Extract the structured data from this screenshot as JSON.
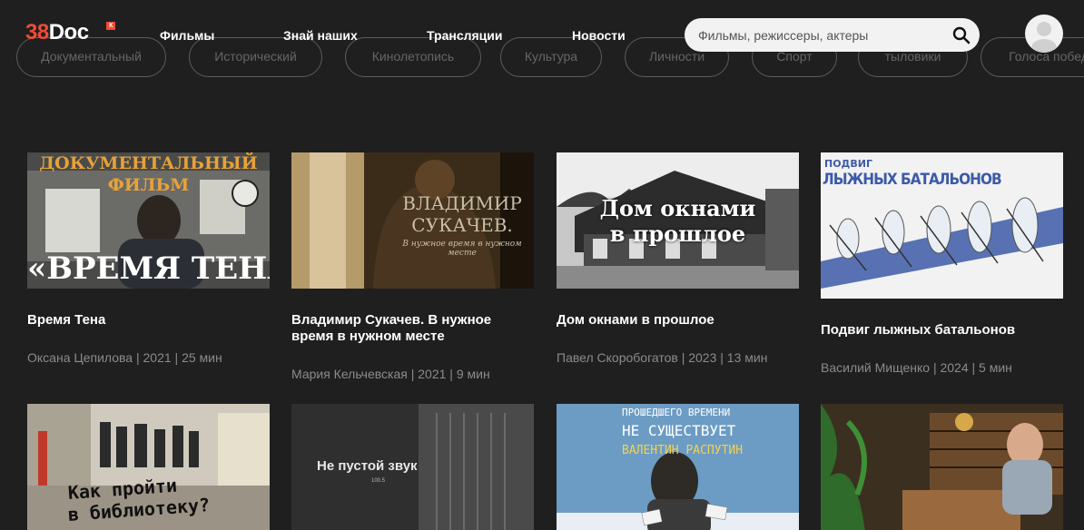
{
  "logo": {
    "number": "38",
    "text": "Doc",
    "mark": "К"
  },
  "nav": {
    "items": [
      "Фильмы",
      "Знай наших",
      "Трансляции",
      "Новости"
    ]
  },
  "search": {
    "placeholder": "Фильмы, режиссеры, актеры",
    "value": ""
  },
  "categories": [
    "Документальный",
    "Исторический",
    "Кинолетопись",
    "Культура",
    "Личности",
    "Спорт",
    "тыловики",
    "Голоса побед"
  ],
  "cards": [
    {
      "title": "Время Тена",
      "meta": "Оксана Цепилова | 2021 | 25 мин",
      "poster_top": "ДОКУМЕНТАЛЬНЫЙ ФИЛЬМ",
      "poster_bottom": "«ВРЕМЯ ТЕНА»"
    },
    {
      "title": "Владимир Сукачев. В нужное время в нужном месте",
      "meta": "Мария Кельчевская | 2021 | 9 мин",
      "poster_name1": "ВЛАДИМИР",
      "poster_name2": "СУКАЧЕВ.",
      "poster_sub": "В нужное время в нужном месте"
    },
    {
      "title": "Дом окнами в прошлое",
      "meta": "Павел Скоробогатов | 2023 | 13 мин",
      "poster_line1": "Дом окнами",
      "poster_line2": "в прошлое"
    },
    {
      "title": "Подвиг лыжных батальонов",
      "meta": "Василий Мищенко | 2024 | 5 мин",
      "poster_line1": "ПОДВИГ",
      "poster_line2": "ЛЫЖНЫХ БАТАЛЬОНОВ"
    },
    {
      "poster_line1": "Как пройти",
      "poster_line2": "в библиотеку?"
    },
    {
      "poster_line1": "Не пустой звук",
      "poster_sub": "100.5"
    },
    {
      "poster_line1": "ПРОШЕДШЕГО ВРЕМЕНИ",
      "poster_line2": "НЕ СУЩЕСТВУЕТ",
      "poster_line3": "ВАЛЕНТИН РАСПУТИН"
    },
    {}
  ],
  "colors": {
    "accent": "#f04a36",
    "background": "#1f1f20",
    "meta_text": "#8b8b8b",
    "pill_border": "#5c5c5c"
  }
}
